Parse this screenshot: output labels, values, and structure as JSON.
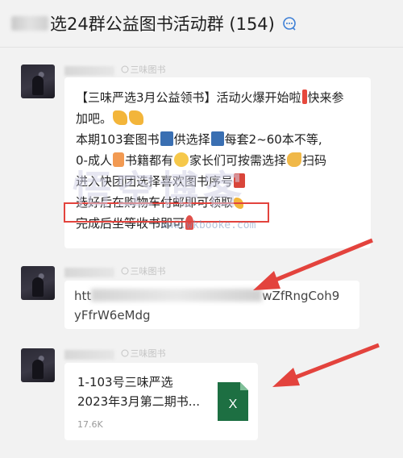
{
  "header": {
    "title": "选24群公益图书活动群 (154)",
    "chat_icon": "chat-bubble-icon"
  },
  "messages": [
    {
      "sender_tag": "三味图书",
      "lines": [
        "【三味严选3月公益领书】活动火爆开始啦",
        "快来参",
        "加吧。",
        "本期103套图书",
        "供选择",
        "每套2~60本不等,",
        "0-成人",
        "书籍都有",
        "家长们可按需选择",
        "扫码",
        "进入快团团选择喜欢图书序号",
        "选好后在购物车付邮即可领取",
        "完成后坐等收书即可"
      ]
    },
    {
      "sender_tag": "三味图书",
      "link_start": "htt",
      "link_end": "wZfRngCoh9",
      "link_line2": "yFfrW6eMdg"
    },
    {
      "sender_tag": "三味图书",
      "file_name_line1": "1-103号三味严选",
      "file_name_line2": "2023年3月第二期书...",
      "file_size": "17.6K",
      "file_icon": "excel-icon",
      "file_icon_letter": "X"
    }
  ],
  "watermark": {
    "main": "悟空博客",
    "sub": "www.wkbooke.com"
  },
  "colors": {
    "annotation_red": "#e3433d",
    "excel_green": "#1d6f42"
  }
}
